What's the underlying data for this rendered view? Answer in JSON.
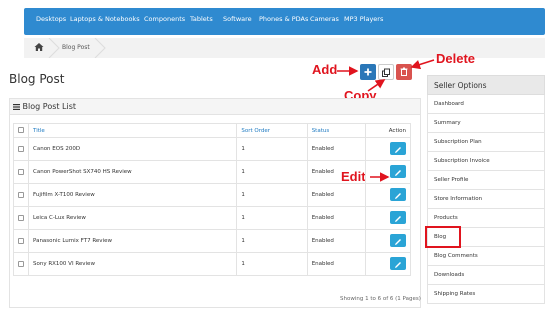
{
  "nav": {
    "items": [
      "Desktops",
      "Laptops & Notebooks",
      "Components",
      "Tablets",
      "Software",
      "Phones & PDAs",
      "Cameras",
      "MP3 Players"
    ]
  },
  "breadcrumb": {
    "current": "Blog Post"
  },
  "page": {
    "title": "Blog Post"
  },
  "panel": {
    "title": "Blog Post List"
  },
  "table": {
    "headers": {
      "title": "Title",
      "sort_order": "Sort Order",
      "status": "Status",
      "action": "Action"
    },
    "rows": [
      {
        "title": "Canon EOS 200D",
        "sort_order": "1",
        "status": "Enabled"
      },
      {
        "title": "Canon PowerShot SX740 HS Review",
        "sort_order": "1",
        "status": "Enabled"
      },
      {
        "title": "Fujifilm X-T100 Review",
        "sort_order": "1",
        "status": "Enabled"
      },
      {
        "title": "Leica C-Lux Review",
        "sort_order": "1",
        "status": "Enabled"
      },
      {
        "title": "Panasonic Lumix FT7 Review",
        "sort_order": "1",
        "status": "Enabled"
      },
      {
        "title": "Sony RX100 VI Review",
        "sort_order": "1",
        "status": "Enabled"
      }
    ]
  },
  "pagination": {
    "text": "Showing 1 to 6 of 6 (1 Pages)"
  },
  "annotations": {
    "add": "Add",
    "copy": "Copy",
    "delete": "Delete",
    "edit": "Edit"
  },
  "sidebar": {
    "title": "Seller Options",
    "items": [
      "Dashboard",
      "Summary",
      "Subscription Plan",
      "Subscription Invoice",
      "Seller Profile",
      "Store Information",
      "Products",
      "Blog",
      "Blog Comments",
      "Downloads",
      "Shipping Rates"
    ]
  },
  "colors": {
    "nav_bg": "#2f8ad0",
    "primary": "#2a77b8",
    "danger": "#d9534f",
    "info": "#2aa4d6",
    "annotation": "#e0141e"
  }
}
